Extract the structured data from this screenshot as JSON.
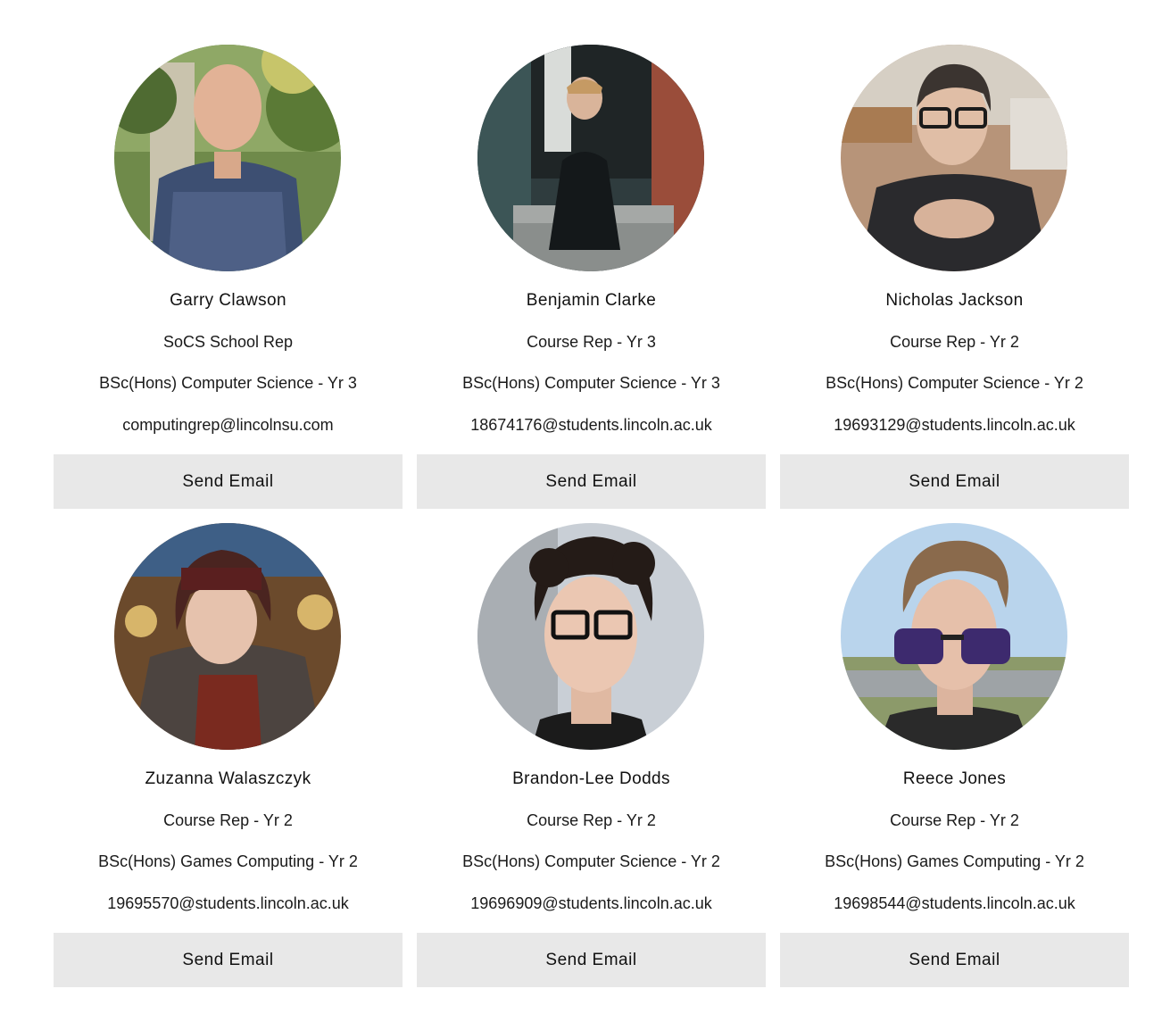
{
  "reps": [
    {
      "name": "Garry Clawson",
      "role": "SoCS School Rep",
      "course": "BSc(Hons) Computer Science - Yr 3",
      "email": "computingrep@lincolnsu.com",
      "button": "Send Email"
    },
    {
      "name": "Benjamin Clarke",
      "role": "Course Rep - Yr 3",
      "course": "BSc(Hons) Computer Science - Yr 3",
      "email": "18674176@students.lincoln.ac.uk",
      "button": "Send Email"
    },
    {
      "name": "Nicholas Jackson",
      "role": "Course Rep - Yr 2",
      "course": "BSc(Hons) Computer Science - Yr 2",
      "email": "19693129@students.lincoln.ac.uk",
      "button": "Send Email"
    },
    {
      "name": "Zuzanna Walaszczyk",
      "role": "Course Rep - Yr 2",
      "course": "BSc(Hons) Games Computing - Yr 2",
      "email": "19695570@students.lincoln.ac.uk",
      "button": "Send Email"
    },
    {
      "name": "Brandon-Lee Dodds",
      "role": "Course Rep - Yr 2",
      "course": "BSc(Hons) Computer Science - Yr 2",
      "email": "19696909@students.lincoln.ac.uk",
      "button": "Send Email"
    },
    {
      "name": "Reece Jones",
      "role": "Course Rep - Yr 2",
      "course": "BSc(Hons) Games Computing - Yr 2",
      "email": "19698544@students.lincoln.ac.uk",
      "button": "Send Email"
    }
  ]
}
